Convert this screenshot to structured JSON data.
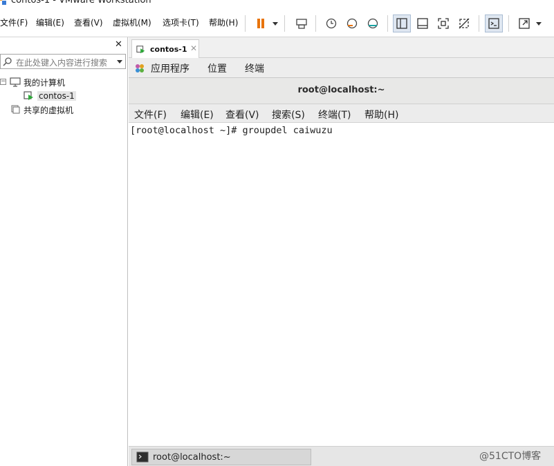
{
  "window": {
    "title": "contos-1 - VMware Workstation"
  },
  "menu": {
    "items": [
      "文件(F)",
      "编辑(E)",
      "查看(V)",
      "虚拟机(M)",
      "选项卡(T)",
      "帮助(H)"
    ]
  },
  "toolbar": {
    "icons": [
      "pause-icon",
      "send-keys-icon",
      "snapshot-icon",
      "revert-snapshot-icon",
      "snapshot-manager-icon",
      "library-view-icon",
      "thumbnail-bar-icon",
      "fullscreen-icon",
      "unity-icon",
      "console-view-icon",
      "stretch-icon"
    ],
    "accent": "#e8740c"
  },
  "library": {
    "search_placeholder": "在此处键入内容进行搜索",
    "tree": {
      "my_computer": "我的计算机",
      "vm": "contos-1",
      "shared": "共享的虚拟机"
    }
  },
  "tabs": [
    {
      "label": "contos-1"
    }
  ],
  "gnome_panel": {
    "applications": "应用程序",
    "places": "位置",
    "terminal": "终端"
  },
  "terminal": {
    "title": "root@localhost:~",
    "menu": [
      "文件(F)",
      "编辑(E)",
      "查看(V)",
      "搜索(S)",
      "终端(T)",
      "帮助(H)"
    ],
    "line": "[root@localhost ~]# groupdel caiwuzu"
  },
  "taskbar": {
    "label": "root@localhost:~"
  },
  "watermark": "@51CTO博客"
}
